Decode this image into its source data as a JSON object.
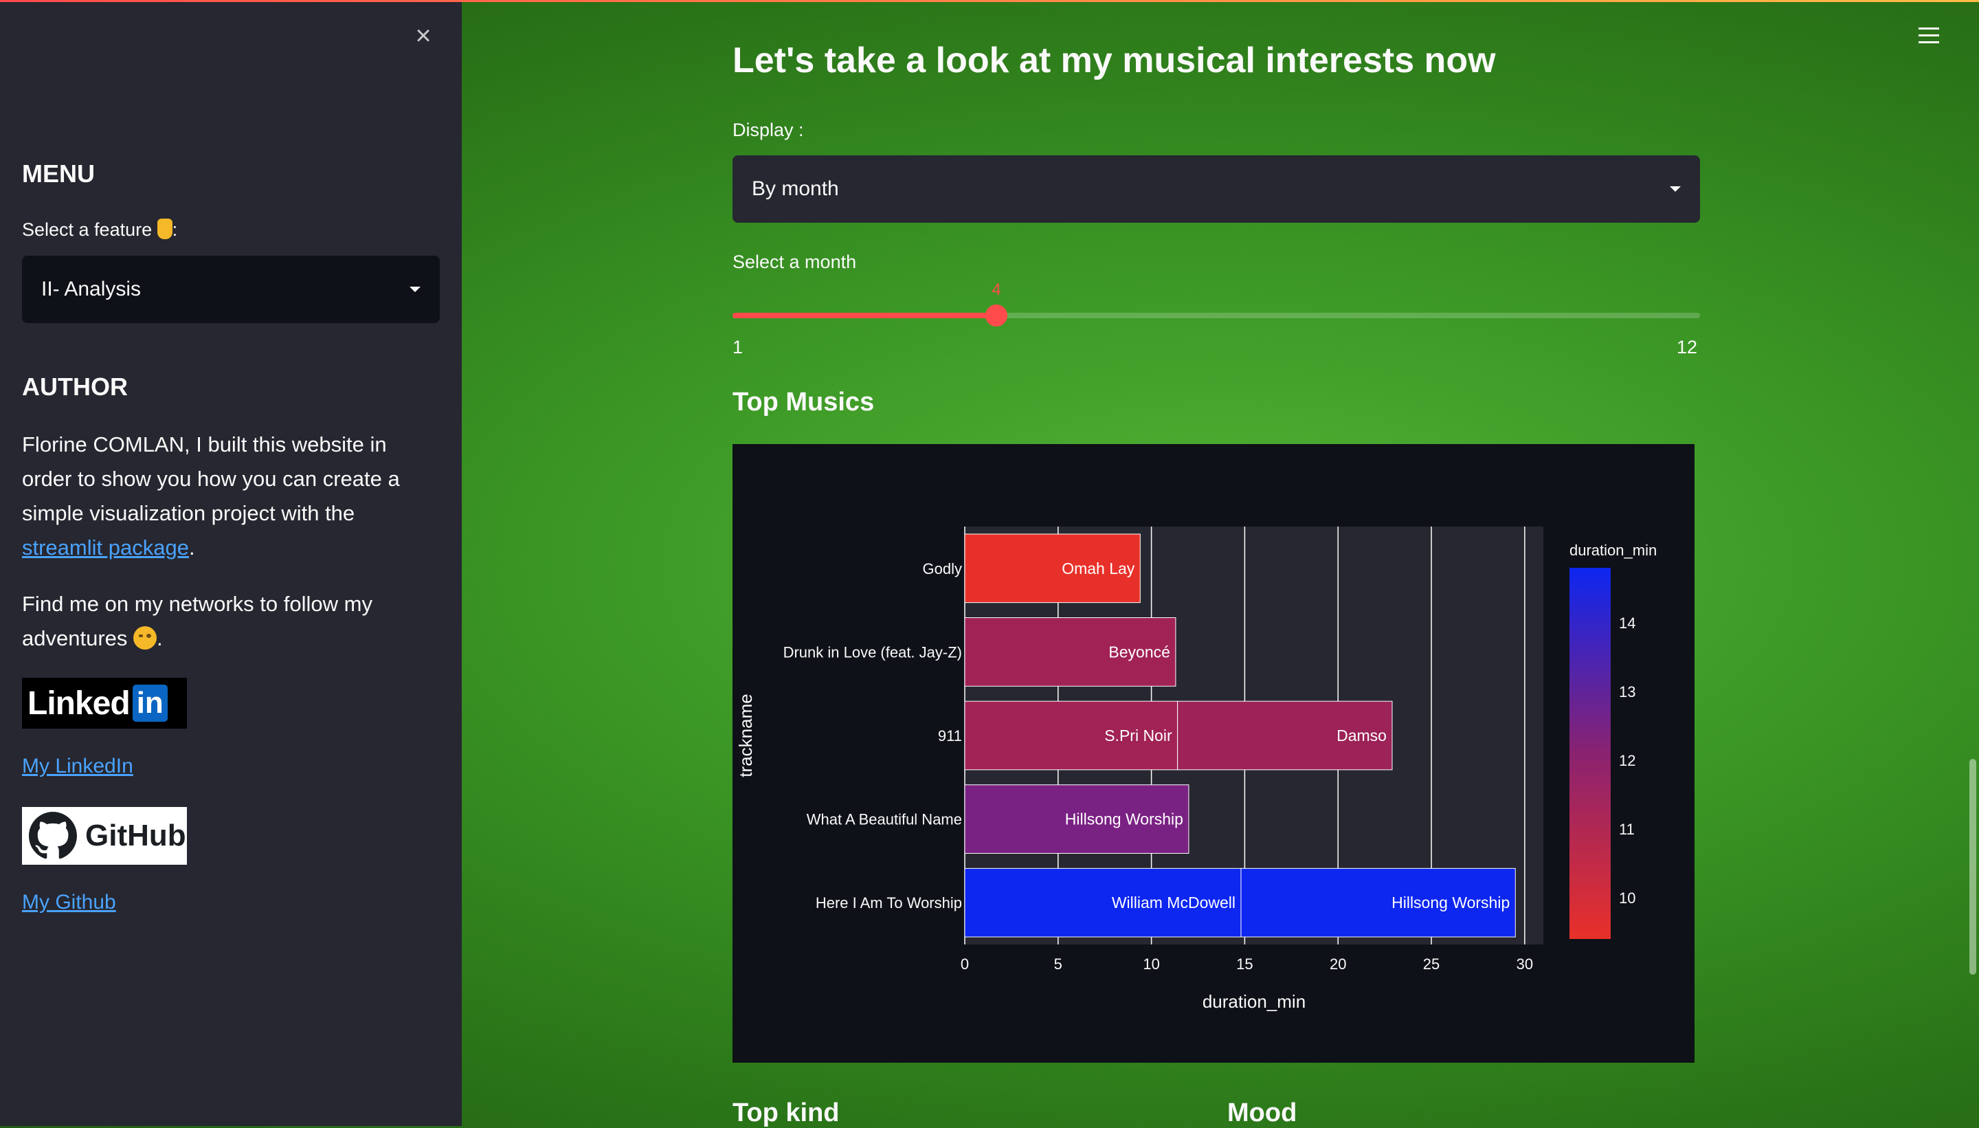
{
  "sidebar": {
    "menu_title": "MENU",
    "feature_label": "Select a feature",
    "feature_value": "II- Analysis",
    "author_title": "AUTHOR",
    "author_text_before": "Florine COMLAN, I built this website in order to show you how you can create a simple visualization project with the",
    "author_link": "streamlit package",
    "author_text_after": ".",
    "follow_text": "Find me on my networks to follow my adventures",
    "linkedin_badge": "Linked",
    "linkedin_badge_in": "in",
    "linkedin_link": "My LinkedIn",
    "github_badge": "GitHub",
    "github_link": "My Github"
  },
  "main": {
    "title": "Let's take a look at my musical interests now",
    "display_label": "Display :",
    "display_value": "By month",
    "month_label": "Select a month",
    "slider": {
      "min": 1,
      "max": 12,
      "value": 4,
      "min_label": "1",
      "max_label": "12",
      "value_label": "4"
    },
    "top_musics_title": "Top Musics",
    "top_kind_title": "Top kind",
    "mood_title": "Mood"
  },
  "chart_data": {
    "type": "bar",
    "orientation": "horizontal",
    "stacked": true,
    "xlabel": "duration_min",
    "ylabel": "trackname",
    "xlim": [
      0,
      31
    ],
    "xticks": [
      0,
      5,
      10,
      15,
      20,
      25,
      30
    ],
    "categories": [
      "Godly",
      "Drunk in Love (feat. Jay-Z)",
      "911",
      "What A Beautiful Name",
      "Here I Am To Worship"
    ],
    "segments": [
      {
        "track": "Godly",
        "artist": "Omah Lay",
        "value": 9.4,
        "color": "#e8302a"
      },
      {
        "track": "Drunk in Love (feat. Jay-Z)",
        "artist": "Beyoncé",
        "value": 11.3,
        "color": "#a12255"
      },
      {
        "track": "911",
        "artist": "S.Pri Noir",
        "value": 11.4,
        "color": "#a12255"
      },
      {
        "track": "911",
        "artist": "Damso",
        "value": 11.5,
        "color": "#9c2257"
      },
      {
        "track": "What A Beautiful Name",
        "artist": "Hillsong Worship",
        "value": 12.0,
        "color": "#7a2283"
      },
      {
        "track": "Here I Am To Worship",
        "artist": "William McDowell",
        "value": 14.8,
        "color": "#0d26f0"
      },
      {
        "track": "Here I Am To Worship",
        "artist": "Hillsong Worship",
        "value": 14.7,
        "color": "#0d26f0"
      }
    ],
    "colorbar": {
      "title": "duration_min",
      "ticks": [
        10,
        11,
        12,
        13,
        14
      ],
      "range": [
        9.4,
        14.8
      ],
      "colors": [
        "#e8302a",
        "#0d26f0"
      ]
    }
  }
}
